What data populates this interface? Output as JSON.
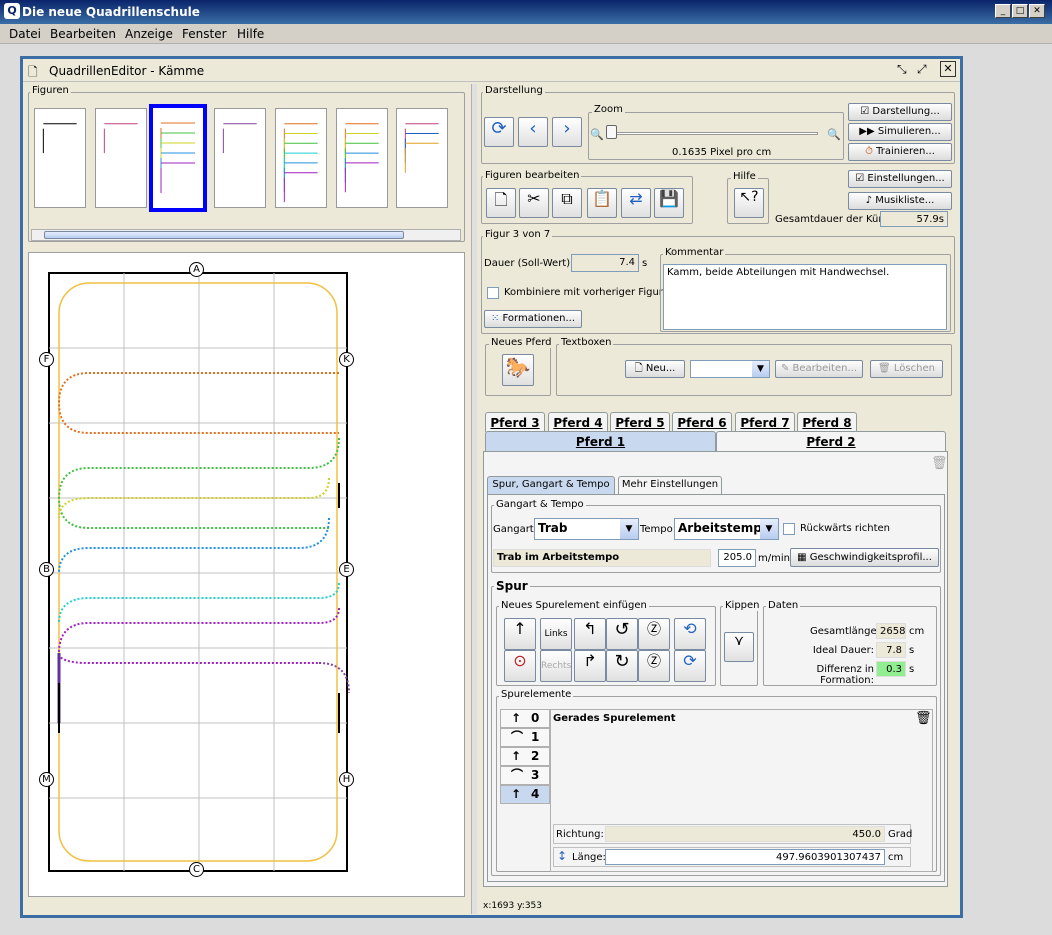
{
  "app": {
    "title": "Die neue Quadrillenschule"
  },
  "menu": [
    "Datei",
    "Bearbeiten",
    "Anzeige",
    "Fenster",
    "Hilfe"
  ],
  "editor": {
    "title": "QuadrillenEditor - Kämme"
  },
  "figures": {
    "label": "Figuren",
    "count": 7,
    "selected_index": 2
  },
  "arena": {
    "letters": [
      "A",
      "F",
      "K",
      "B",
      "E",
      "M",
      "H",
      "C"
    ]
  },
  "darstellung": {
    "label": "Darstellung",
    "zoom_label": "Zoom",
    "zoom_value": "0.1635 Pixel pro cm",
    "btn_darstellung": "Darstellung...",
    "btn_simulieren": "Simulieren...",
    "btn_trainieren": "Trainieren..."
  },
  "figuren_bearbeiten": {
    "label": "Figuren bearbeiten"
  },
  "hilfe": {
    "label": "Hilfe"
  },
  "einstellungen": {
    "btn": "Einstellungen...",
    "musik": "Musikliste...",
    "gesamtdauer_label": "Gesamtdauer der Kür:",
    "gesamtdauer_value": "57.9s"
  },
  "figur": {
    "label": "Figur 3 von 7",
    "dauer_label": "Dauer (Soll-Wert):",
    "dauer_value": "7.4",
    "dauer_unit": "s",
    "kombiniere": "Kombiniere mit vorheriger Figur",
    "formationen": "Formationen...",
    "kommentar_label": "Kommentar",
    "kommentar": "Kamm, beide Abteilungen mit Handwechsel."
  },
  "neues_pferd": {
    "label": "Neues Pferd"
  },
  "textboxen": {
    "label": "Textboxen",
    "neu": "Neu...",
    "bearbeiten": "Bearbeiten...",
    "loeschen": "Löschen"
  },
  "tabs_row1": [
    "Pferd 3",
    "Pferd 4",
    "Pferd 5",
    "Pferd 6",
    "Pferd 7",
    "Pferd 8"
  ],
  "tabs_row2": [
    "Pferd 1",
    "Pferd 2"
  ],
  "subtabs": [
    "Spur, Gangart & Tempo",
    "Mehr Einstellungen"
  ],
  "gangart": {
    "label": "Gangart & Tempo",
    "gangart_label": "Gangart:",
    "gangart_value": "Trab",
    "tempo_label": "Tempo:",
    "tempo_value": "Arbeitstempo",
    "rueckwaerts": "Rückwärts richten",
    "summary": "Trab im Arbeitstempo",
    "speed": "205.0",
    "speed_unit": "m/min",
    "profil": "Geschwindigkeitsprofil..."
  },
  "spur": {
    "label": "Spur",
    "neues_label": "Neues Spurelement einfügen",
    "links": "Links",
    "rechts": "Rechts",
    "kippen": "Kippen",
    "daten": "Daten",
    "gesamtlaenge_label": "Gesamtlänge:",
    "gesamtlaenge": "2658",
    "gesamtlaenge_unit": "cm",
    "ideal_label": "Ideal Dauer:",
    "ideal": "7.8",
    "ideal_unit": "s",
    "differenz_label": "Differenz in Formation:",
    "differenz": "0.3",
    "differenz_unit": "s"
  },
  "spurelemente": {
    "label": "Spurelemente",
    "items": [
      "0",
      "1",
      "2",
      "3",
      "4"
    ],
    "selected": "Gerades Spurelement",
    "richtung_label": "Richtung:",
    "richtung": "450.0",
    "richtung_unit": "Grad",
    "laenge_label": "Länge:",
    "laenge": "497.9603901307437",
    "laenge_unit": "cm"
  },
  "status": {
    "coords": "x:1693 y:353"
  },
  "colors": {
    "accent": "#3a6ea5",
    "selected_thumb": "#0000ff",
    "differenz_bg": "#90ee90"
  }
}
